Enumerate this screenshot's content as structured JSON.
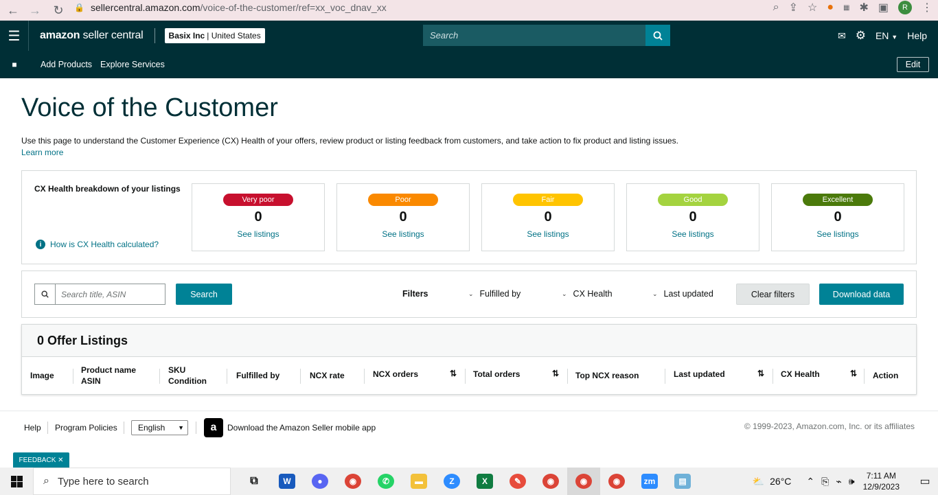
{
  "browser": {
    "url_host": "sellercentral.amazon.com",
    "url_path": "/voice-of-the-customer/ref=xx_voc_dnav_xx",
    "profile_initial": "R"
  },
  "header": {
    "logo_bold": "amazon",
    "logo_light": "seller central",
    "account_name": "Basix Inc",
    "account_region": "United States",
    "search_placeholder": "Search",
    "lang": "EN",
    "help": "Help"
  },
  "subnav": {
    "links": [
      "Add Products",
      "Explore Services"
    ],
    "edit_label": "Edit"
  },
  "page": {
    "title": "Voice of the Customer",
    "description": "Use this page to understand the Customer Experience (CX) Health of your offers, review product or listing feedback from customers, and take action to fix product and listing issues.",
    "learn_more": "Learn more"
  },
  "health": {
    "title": "CX Health breakdown of your listings",
    "info_link": "How is CX Health calculated?",
    "tiles": [
      {
        "label": "Very poor",
        "count": "0",
        "link": "See listings",
        "color": "#c7102e"
      },
      {
        "label": "Poor",
        "count": "0",
        "link": "See listings",
        "color": "#fa8900"
      },
      {
        "label": "Fair",
        "count": "0",
        "link": "See listings",
        "color": "#ffc400"
      },
      {
        "label": "Good",
        "count": "0",
        "link": "See listings",
        "color": "#a4d33f"
      },
      {
        "label": "Excellent",
        "count": "0",
        "link": "See listings",
        "color": "#4b7a0b"
      }
    ]
  },
  "filters": {
    "search_placeholder": "Search title, ASIN",
    "search_button": "Search",
    "filters_label": "Filters",
    "dropdowns": [
      "Fulfilled by",
      "CX Health",
      "Last updated"
    ],
    "clear_button": "Clear filters",
    "download_button": "Download data"
  },
  "table": {
    "title": "0 Offer Listings",
    "columns": {
      "image": "Image",
      "product_name": "Product name",
      "asin": "ASIN",
      "sku": "SKU",
      "condition": "Condition",
      "fulfilled_by": "Fulfilled by",
      "ncx_rate": "NCX rate",
      "ncx_orders": "NCX orders",
      "total_orders": "Total orders",
      "top_ncx_reason": "Top NCX reason",
      "last_updated": "Last updated",
      "cx_health": "CX Health",
      "action": "Action"
    }
  },
  "footer": {
    "help": "Help",
    "policies": "Program Policies",
    "language": "English",
    "app_text": "Download the Amazon Seller mobile app",
    "copyright": "© 1999-2023, Amazon.com, Inc. or its affiliates"
  },
  "feedback": "FEEDBACK ✕",
  "taskbar": {
    "search_placeholder": "Type here to search",
    "temperature": "26°C",
    "time": "7:11 AM",
    "date": "12/9/2023"
  }
}
